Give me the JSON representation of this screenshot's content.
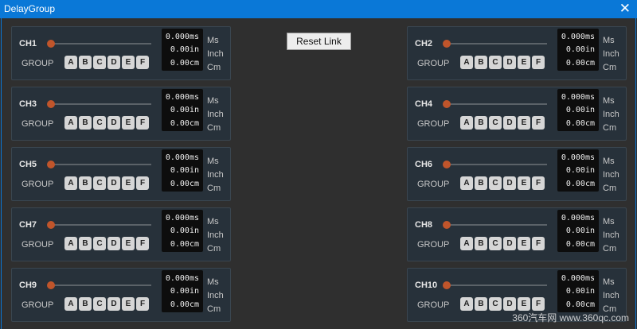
{
  "window": {
    "title": "DelayGroup",
    "close_glyph": "✕"
  },
  "reset_label": "Reset Link",
  "group_label": "GROUP",
  "group_buttons": [
    "A",
    "B",
    "C",
    "D",
    "E",
    "F"
  ],
  "units": {
    "ms": "Ms",
    "inch": "Inch",
    "cm": "Cm"
  },
  "channels": [
    {
      "name": "CH1",
      "ms": "0.000ms",
      "inch": "0.00in",
      "cm": "0.00cm",
      "delay_fraction": 0
    },
    {
      "name": "CH2",
      "ms": "0.000ms",
      "inch": "0.00in",
      "cm": "0.00cm",
      "delay_fraction": 0
    },
    {
      "name": "CH3",
      "ms": "0.000ms",
      "inch": "0.00in",
      "cm": "0.00cm",
      "delay_fraction": 0
    },
    {
      "name": "CH4",
      "ms": "0.000ms",
      "inch": "0.00in",
      "cm": "0.00cm",
      "delay_fraction": 0
    },
    {
      "name": "CH5",
      "ms": "0.000ms",
      "inch": "0.00in",
      "cm": "0.00cm",
      "delay_fraction": 0
    },
    {
      "name": "CH6",
      "ms": "0.000ms",
      "inch": "0.00in",
      "cm": "0.00cm",
      "delay_fraction": 0
    },
    {
      "name": "CH7",
      "ms": "0.000ms",
      "inch": "0.00in",
      "cm": "0.00cm",
      "delay_fraction": 0
    },
    {
      "name": "CH8",
      "ms": "0.000ms",
      "inch": "0.00in",
      "cm": "0.00cm",
      "delay_fraction": 0
    },
    {
      "name": "CH9",
      "ms": "0.000ms",
      "inch": "0.00in",
      "cm": "0.00cm",
      "delay_fraction": 0
    },
    {
      "name": "CH10",
      "ms": "0.000ms",
      "inch": "0.00in",
      "cm": "0.00cm",
      "delay_fraction": 0
    }
  ],
  "watermark": "360汽车网 www.360qc.com",
  "colors": {
    "titlebar": "#0a78d7",
    "knob": "#c0552b",
    "panel": "#27313a"
  }
}
